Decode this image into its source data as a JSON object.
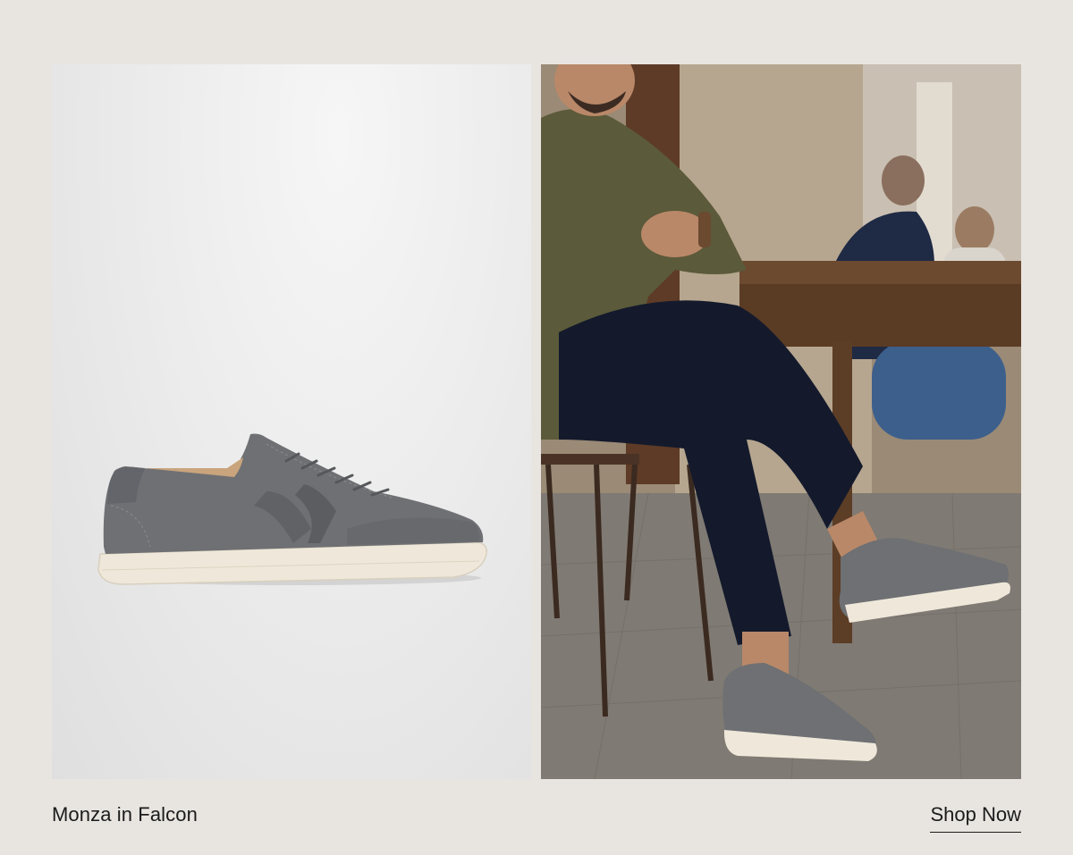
{
  "product": {
    "caption": "Monza in Falcon"
  },
  "cta": {
    "label": "Shop Now"
  },
  "images": {
    "product_image": "gray-suede-sneaker-side-view",
    "lifestyle_image": "man-seated-at-outdoor-cafe-wearing-gray-sneakers"
  },
  "colors": {
    "background": "#e8e5e1",
    "text": "#1b1b1b",
    "shoe_suede": "#6b6d70",
    "sole": "#efe8da"
  }
}
